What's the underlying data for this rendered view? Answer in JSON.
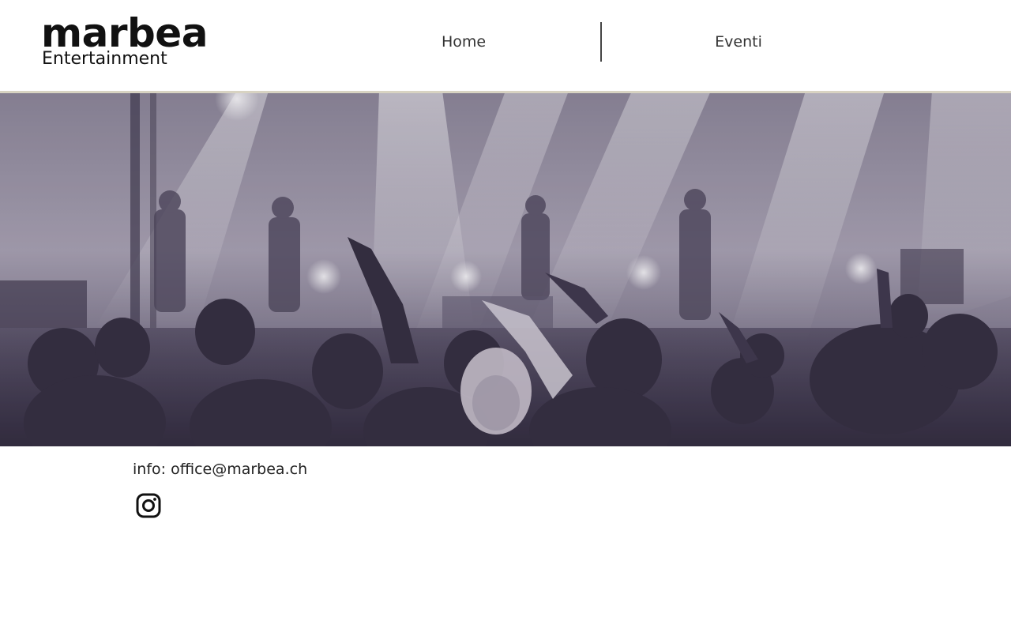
{
  "brand": {
    "name": "marbea",
    "tagline": "Entertainment"
  },
  "nav": {
    "items": [
      {
        "label": "Home"
      },
      {
        "label": "Eventi"
      }
    ]
  },
  "hero": {
    "image": "concert-crowd-photo"
  },
  "contact": {
    "label": "info:",
    "email": "office@marbea.ch"
  },
  "social": {
    "icon": "instagram-icon"
  },
  "colors": {
    "text": "#1a1a1a",
    "nav_text": "#333333",
    "hero_tint": "#5b5468",
    "divider": "#444444"
  }
}
